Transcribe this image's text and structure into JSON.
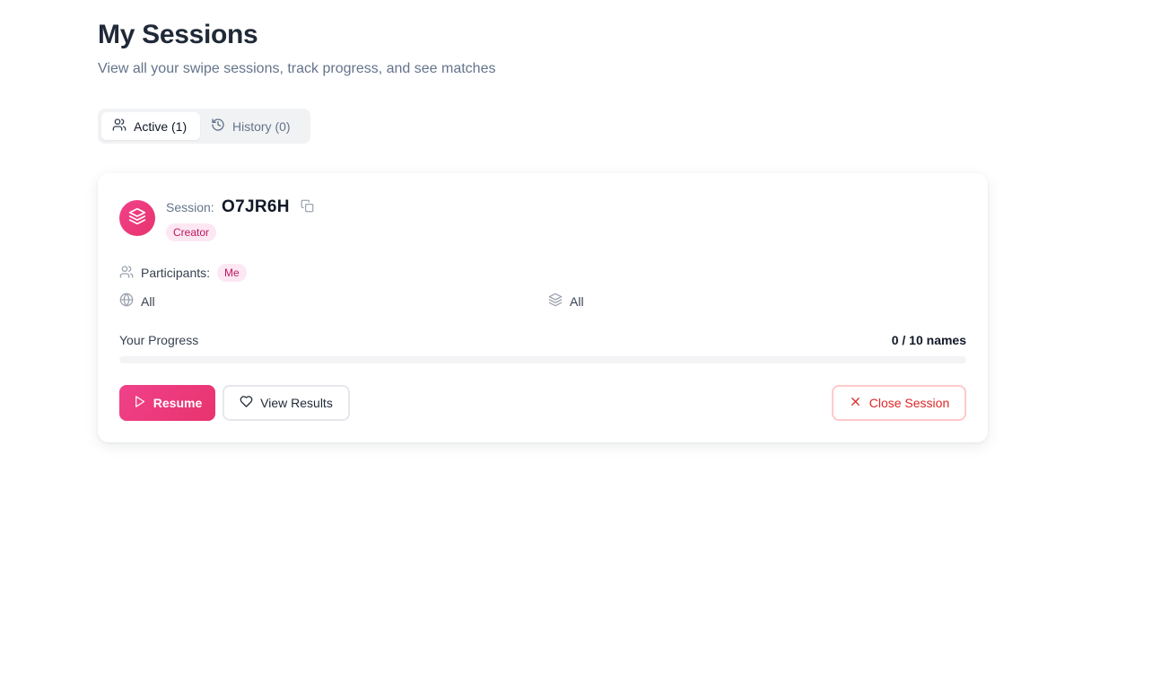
{
  "header": {
    "title": "My Sessions",
    "subtitle": "View all your swipe sessions, track progress, and see matches"
  },
  "tabs": [
    {
      "label": "Active (1)",
      "icon": "users-icon",
      "active": true
    },
    {
      "label": "History (0)",
      "icon": "history-icon",
      "active": false
    }
  ],
  "session": {
    "label": "Session:",
    "code": "O7JR6H",
    "role_badge": "Creator",
    "participants_label": "Participants:",
    "participants": [
      "Me"
    ],
    "region_filter": "All",
    "category_filter": "All",
    "progress_label": "Your Progress",
    "progress_text": "0 / 10 names",
    "progress_done": 0,
    "progress_total": 10,
    "resume_label": "Resume",
    "view_results_label": "View Results",
    "close_label": "Close Session"
  },
  "colors": {
    "accent": "#ec4899",
    "badge_bg": "#fce7f3",
    "badge_text": "#be185d",
    "danger": "#dc2626"
  }
}
